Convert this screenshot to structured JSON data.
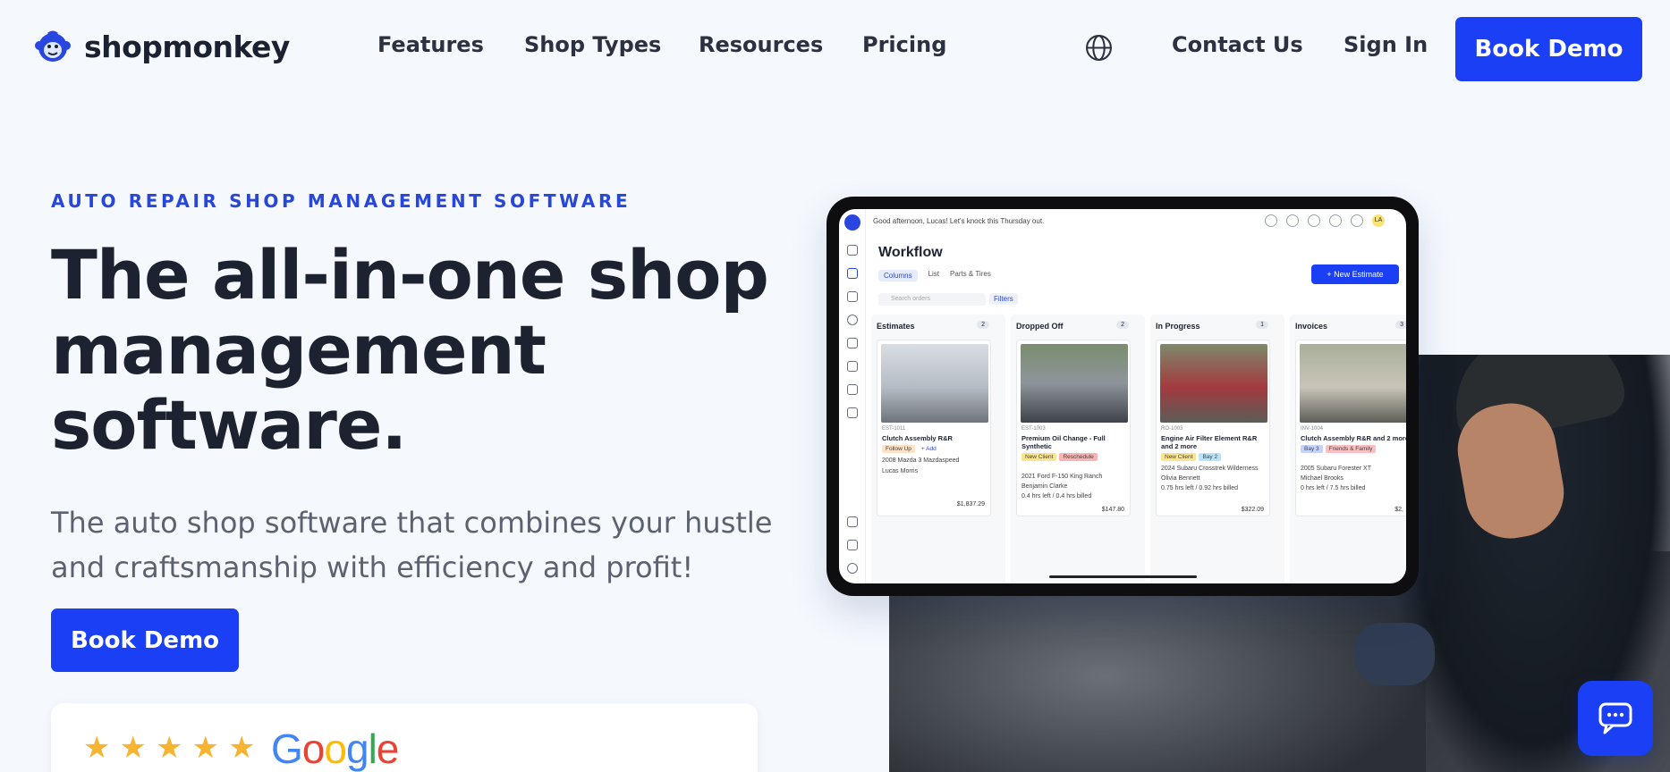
{
  "nav": {
    "brand": "shopmonkey",
    "links": [
      "Features",
      "Shop Types",
      "Resources",
      "Pricing"
    ],
    "contact": "Contact Us",
    "signin": "Sign In",
    "demo": "Book Demo"
  },
  "hero": {
    "eyebrow": "AUTO REPAIR SHOP MANAGEMENT SOFTWARE",
    "headline": "The all-in-one shop management software.",
    "sub": "The auto shop software that combines your hustle and craftsmanship with efficiency and profit!",
    "demo": "Book Demo",
    "review_brand": "Google",
    "rating_stars": 5
  },
  "app": {
    "greeting": "Good afternoon, Lucas! Let's knock this Thursday out.",
    "avatar": "LA",
    "title": "Workflow",
    "views": [
      "Columns",
      "List",
      "Parts & Tires"
    ],
    "new_estimate": "+ New Estimate",
    "search_placeholder": "Search orders",
    "filters": "Filters",
    "lanes": [
      {
        "title": "Estimates",
        "count": "2",
        "id": "EST-1011",
        "name": "Clutch Assembly R&R",
        "tags": [
          "Follow Up",
          "+ Add"
        ],
        "vehicle": "2008 Mazda 3 Mazdaspeed",
        "customer": "Lucas Morris",
        "amount": "$1,837.29"
      },
      {
        "title": "Dropped Off",
        "count": "2",
        "id": "EST-1003",
        "name": "Premium Oil Change - Full Synthetic",
        "tags": [
          "New Client",
          "Reschedule"
        ],
        "vehicle": "2021 Ford F-150 King Ranch",
        "customer": "Benjamin Clarke",
        "hours": "0.4 hrs left / 0.4 hrs billed",
        "amount": "$147.80"
      },
      {
        "title": "In Progress",
        "count": "1",
        "id": "RO-1003",
        "name": "Engine Air Filter Element R&R and 2 more",
        "tags": [
          "New Client",
          "Bay 2"
        ],
        "vehicle": "2024 Subaru Crosstrek Wilderness",
        "customer": "Olivia Bennett",
        "hours": "0.75 hrs left / 0.92 hrs billed",
        "amount": "$322.09"
      },
      {
        "title": "Invoices",
        "count": "3",
        "id": "INV-1004",
        "name": "Clutch Assembly R&R and 2 more",
        "tags": [
          "Bay 3",
          "Friends & Family"
        ],
        "vehicle": "2005 Subaru Forester XT",
        "customer": "Michael Brooks",
        "hours": "0 hrs left / 7.5 hrs billed",
        "amount": "$2,"
      }
    ]
  },
  "colors": {
    "accent": "#1b3ff5",
    "eyebrow": "#2847d8",
    "star": "#f6b431"
  }
}
